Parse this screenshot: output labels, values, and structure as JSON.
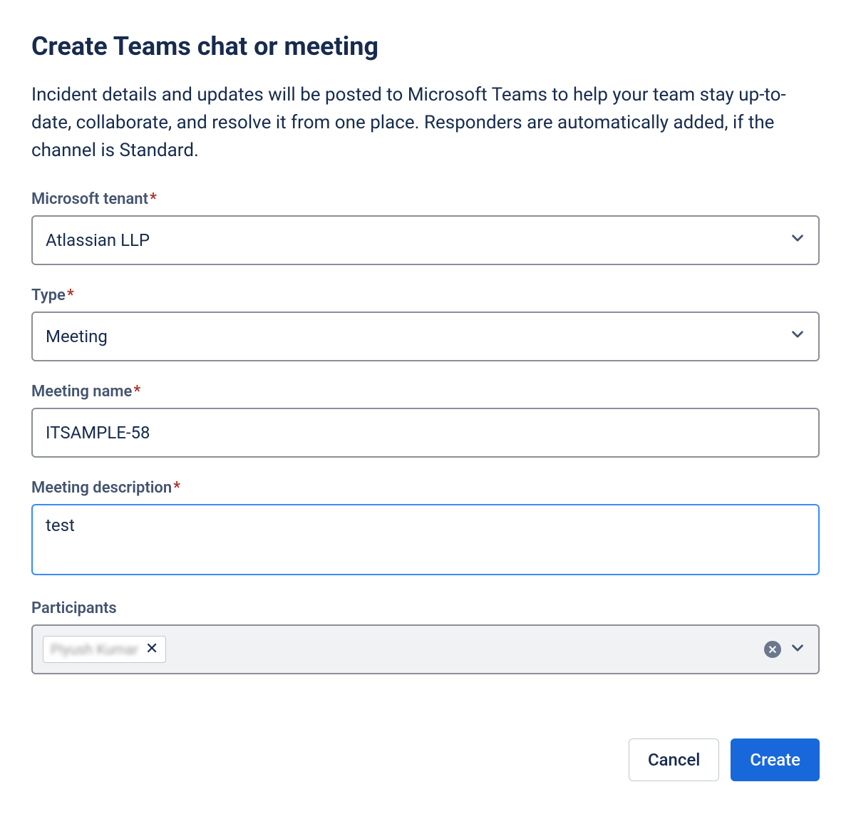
{
  "modal": {
    "title": "Create Teams chat or meeting",
    "description": "Incident details and updates will be posted to Microsoft Teams to help your team stay up-to-date, collaborate, and resolve it from one place. Responders are automatically added, if the channel is Standard."
  },
  "fields": {
    "tenant": {
      "label": "Microsoft tenant",
      "value": "Atlassian LLP",
      "required_marker": "*"
    },
    "type": {
      "label": "Type",
      "value": "Meeting",
      "required_marker": "*"
    },
    "meeting_name": {
      "label": "Meeting name",
      "value": "ITSAMPLE-58",
      "required_marker": "*"
    },
    "meeting_description": {
      "label": "Meeting description",
      "value": "test",
      "required_marker": "*"
    },
    "participants": {
      "label": "Participants",
      "selected": [
        "Piyush Kumar"
      ]
    }
  },
  "buttons": {
    "cancel": "Cancel",
    "create": "Create"
  },
  "icons": {
    "remove_x": "✕",
    "clear_x": "✕"
  }
}
